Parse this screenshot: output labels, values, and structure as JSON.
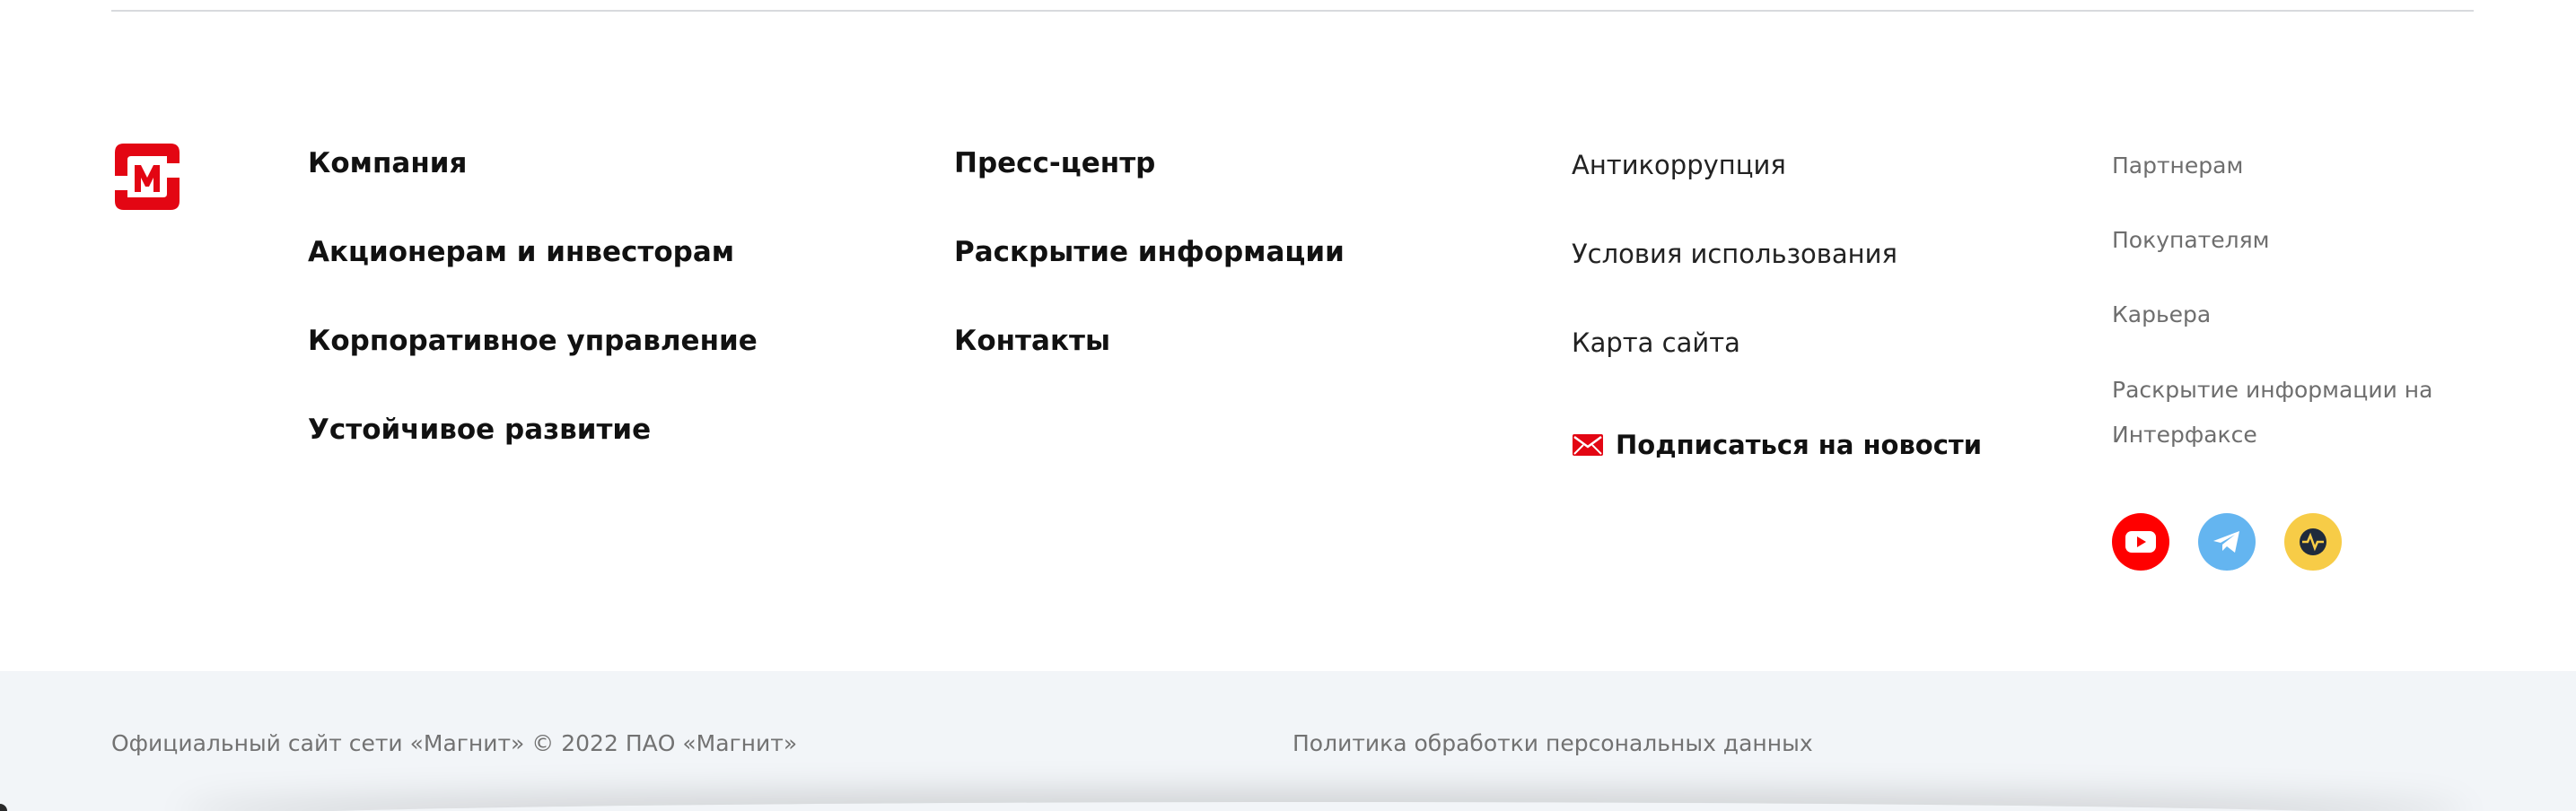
{
  "logo": {
    "name": "magnit-logo",
    "color": "#e30613"
  },
  "nav": {
    "col1": [
      "Компания",
      "Акционерам и инвесторам",
      "Корпоративное управление",
      "Устойчивое развитие"
    ],
    "col2": [
      "Пресс-центр",
      "Раскрытие информации",
      "Контакты"
    ],
    "col3": [
      "Антикоррупция",
      "Условия использования",
      "Карта сайта"
    ],
    "col4": [
      "Партнерам",
      "Покупателям",
      "Карьера",
      "Раскрытие информации на Интерфаксе"
    ]
  },
  "subscribe": {
    "label": "Подписаться на новости",
    "icon": "mail-icon"
  },
  "social": [
    {
      "name": "youtube-icon",
      "color": "#ff0000"
    },
    {
      "name": "telegram-icon",
      "color": "#64b5f0"
    },
    {
      "name": "zen-icon",
      "color": "#f7cc47"
    }
  ],
  "footer": {
    "copyright": "Официальный сайт сети «Магнит» © 2022 ПАО «Магнит»",
    "policy": "Политика обработки персональных данных"
  },
  "colors": {
    "brand": "#e30613",
    "bottom_bar": "#f2f5f8"
  }
}
